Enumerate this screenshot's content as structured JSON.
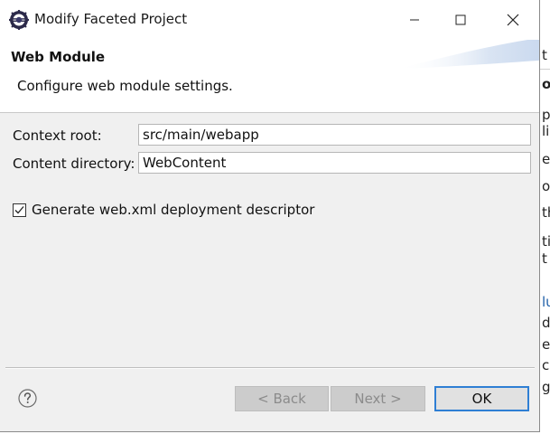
{
  "window": {
    "title": "Modify Faceted Project",
    "icon": "eclipse-icon"
  },
  "header": {
    "title": "Web Module",
    "description": "Configure web module settings."
  },
  "form": {
    "context_root_label": "Context root:",
    "context_root_value": "src/main/webapp",
    "content_directory_label": "Content directory:",
    "content_directory_value": "WebContent",
    "generate_checkbox_label": "Generate web.xml deployment descriptor",
    "generate_checked": true
  },
  "buttons": {
    "back": "< Back",
    "next": "Next >",
    "ok": "OK"
  },
  "background_window": {
    "fragments": [
      "t",
      "o",
      "p",
      "li",
      "e",
      "o",
      "th",
      "ti",
      "t W",
      "lu",
      "du",
      "e",
      "c",
      "g"
    ]
  },
  "colors": {
    "accent": "#2f7fd4",
    "dialog_bg": "#f0f0f0",
    "disabled_button_bg": "#cccccc",
    "disabled_text": "#8b8b8b"
  }
}
